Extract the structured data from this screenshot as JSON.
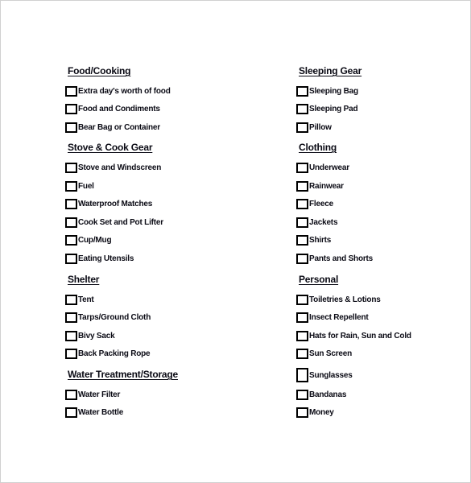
{
  "document": {
    "columns": [
      {
        "sections": [
          {
            "heading": "Food/Cooking",
            "items": [
              "Extra day's worth of food",
              "Food and Condiments",
              "Bear Bag or Container"
            ]
          },
          {
            "heading": "Stove & Cook Gear",
            "items": [
              "Stove and Windscreen",
              "Fuel",
              "Waterproof Matches",
              "Cook Set and Pot Lifter",
              "Cup/Mug",
              "Eating Utensils"
            ]
          },
          {
            "heading": "Shelter",
            "items": [
              "Tent",
              "Tarps/Ground Cloth",
              "Bivy Sack",
              "Back Packing Rope"
            ]
          },
          {
            "heading": "Water Treatment/Storage",
            "items": [
              "Water Filter",
              "Water Bottle"
            ]
          }
        ]
      },
      {
        "sections": [
          {
            "heading": "Sleeping Gear",
            "items": [
              "Sleeping Bag",
              "Sleeping Pad",
              "Pillow"
            ]
          },
          {
            "heading": "Clothing",
            "items": [
              "Underwear",
              "Rainwear",
              "Fleece",
              "Jackets",
              "Shirts",
              "Pants and Shorts"
            ]
          },
          {
            "heading": "Personal",
            "items": [
              "Toiletries & Lotions",
              "Insect Repellent",
              "Hats for Rain, Sun and Cold",
              "Sun Screen",
              "Sunglasses",
              "Bandanas",
              "Money"
            ]
          }
        ]
      }
    ]
  }
}
